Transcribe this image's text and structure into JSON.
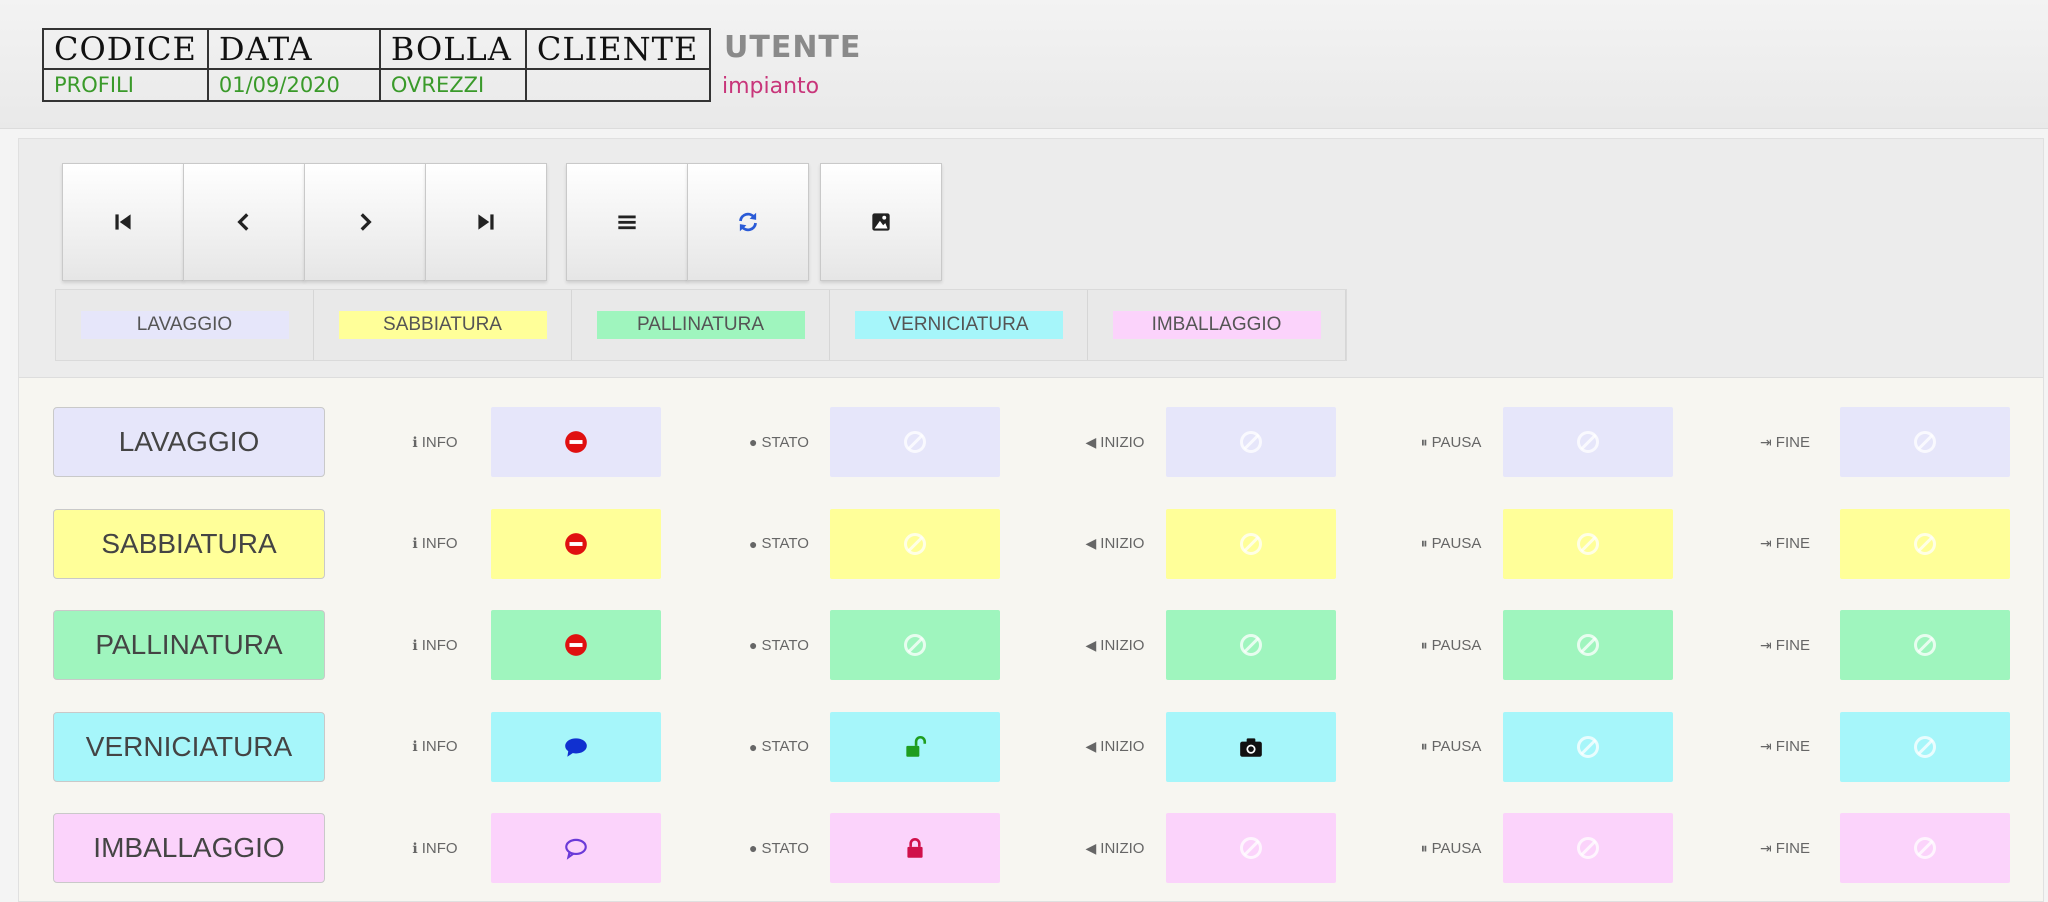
{
  "header": {
    "columns": [
      "CODICE",
      "DATA",
      "BOLLA",
      "CLIENTE"
    ],
    "values": [
      "PROFILI",
      "01/09/2020",
      "OVREZZI",
      ""
    ],
    "utente_label": "UTENTE",
    "utente_value": "impianto"
  },
  "toolbar": {
    "buttons": [
      "first-icon",
      "prev-icon",
      "next-icon",
      "last-icon",
      "list-icon",
      "refresh-icon",
      "image-icon"
    ]
  },
  "legend": [
    {
      "label": "LAVAGGIO",
      "color": "#e6e6fa"
    },
    {
      "label": "SABBIATURA",
      "color": "#ffff99"
    },
    {
      "label": "PALLINATURA",
      "color": "#9ff5be"
    },
    {
      "label": "VERNICIATURA",
      "color": "#a6f6fa"
    },
    {
      "label": "IMBALLAGGIO",
      "color": "#fbd3fb"
    }
  ],
  "column_labels": {
    "info": "INFO",
    "stato": "STATO",
    "inizio": "INIZIO",
    "pausa": "PAUSA",
    "fine": "FINE"
  },
  "phases": [
    {
      "name": "LAVAGGIO",
      "color": "#e6e6fa",
      "info_icon": "no-entry-icon",
      "stato_icon": "ghost",
      "inizio_icon": "ghost",
      "pausa_icon": "ghost",
      "fine_icon": "ghost"
    },
    {
      "name": "SABBIATURA",
      "color": "#ffff99",
      "info_icon": "no-entry-icon",
      "stato_icon": "ghost",
      "inizio_icon": "ghost",
      "pausa_icon": "ghost",
      "fine_icon": "ghost"
    },
    {
      "name": "PALLINATURA",
      "color": "#9ff5be",
      "info_icon": "no-entry-icon",
      "stato_icon": "ghost",
      "inizio_icon": "ghost",
      "pausa_icon": "ghost",
      "fine_icon": "ghost"
    },
    {
      "name": "VERNICIATURA",
      "color": "#a6f6fa",
      "info_icon": "comment-solid-icon",
      "stato_icon": "unlock-icon",
      "inizio_icon": "camera-icon",
      "pausa_icon": "ghost",
      "fine_icon": "ghost"
    },
    {
      "name": "IMBALLAGGIO",
      "color": "#fbd3fb",
      "info_icon": "comment-outline-icon",
      "stato_icon": "lock-icon",
      "inizio_icon": "ghost",
      "pausa_icon": "ghost",
      "fine_icon": "ghost"
    }
  ]
}
